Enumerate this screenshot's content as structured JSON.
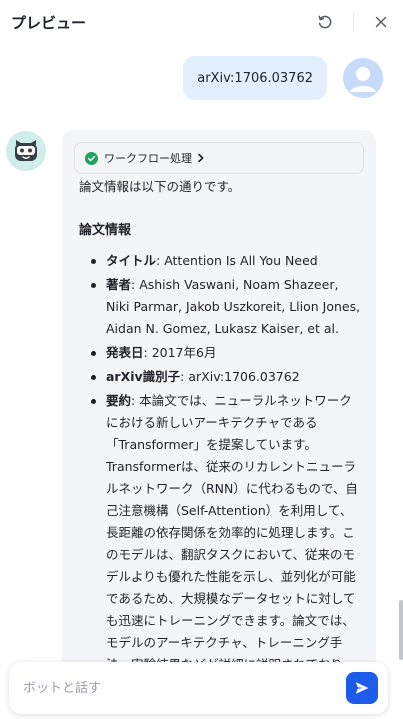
{
  "header": {
    "title": "プレビュー",
    "restart_icon": "restart-icon",
    "close_icon": "close-icon"
  },
  "user_message": {
    "text": "arXiv:1706.03762",
    "avatar_icon": "user-avatar-icon"
  },
  "bot_message": {
    "avatar_icon": "bot-avatar-icon",
    "workflow_label": "ワークフロー処理",
    "workflow_status_icon": "check-circle-icon",
    "intro": "論文情報は以下の通りです。",
    "section_title": "論文情報",
    "items": [
      {
        "label": "タイトル",
        "value": ": Attention Is All You Need"
      },
      {
        "label": "著者",
        "value": ": Ashish Vaswani, Noam Shazeer, Niki Parmar, Jakob Uszkoreit, Llion Jones, Aidan N. Gomez, Lukasz Kaiser, et al."
      },
      {
        "label": "発表日",
        "value": ": 2017年6月"
      },
      {
        "label": "arXiv識別子",
        "value": ": arXiv:1706.03762"
      },
      {
        "label": "要約",
        "value": ": 本論文では、ニューラルネットワークにおける新しいアーキテクチャである「Transformer」を提案しています。Transformerは、従来のリカレントニューラルネットワーク（RNN）に代わるもので、自己注意機構（Self-Attention）を利用して、長距離の依存関係を効率的に処理します。このモデルは、翻訳タスクにおいて、従来のモデルよりも優れた性能を示し、並列化が可能であるため、大規模なデータセットに対しても迅速にトレーニングできます。論文では、モデルのアーキテクチャ、トレーニング手法、実験結果などが詳細に説明されており、自然言語処理の分野における重要な進展を示しています。"
      }
    ]
  },
  "composer": {
    "placeholder": "ボットと話す",
    "send_icon": "send-icon"
  },
  "colors": {
    "accent": "#1d5ce9",
    "user_bubble": "#e1efff",
    "bot_bubble": "#f4f5f7",
    "success": "#1fa35b"
  }
}
